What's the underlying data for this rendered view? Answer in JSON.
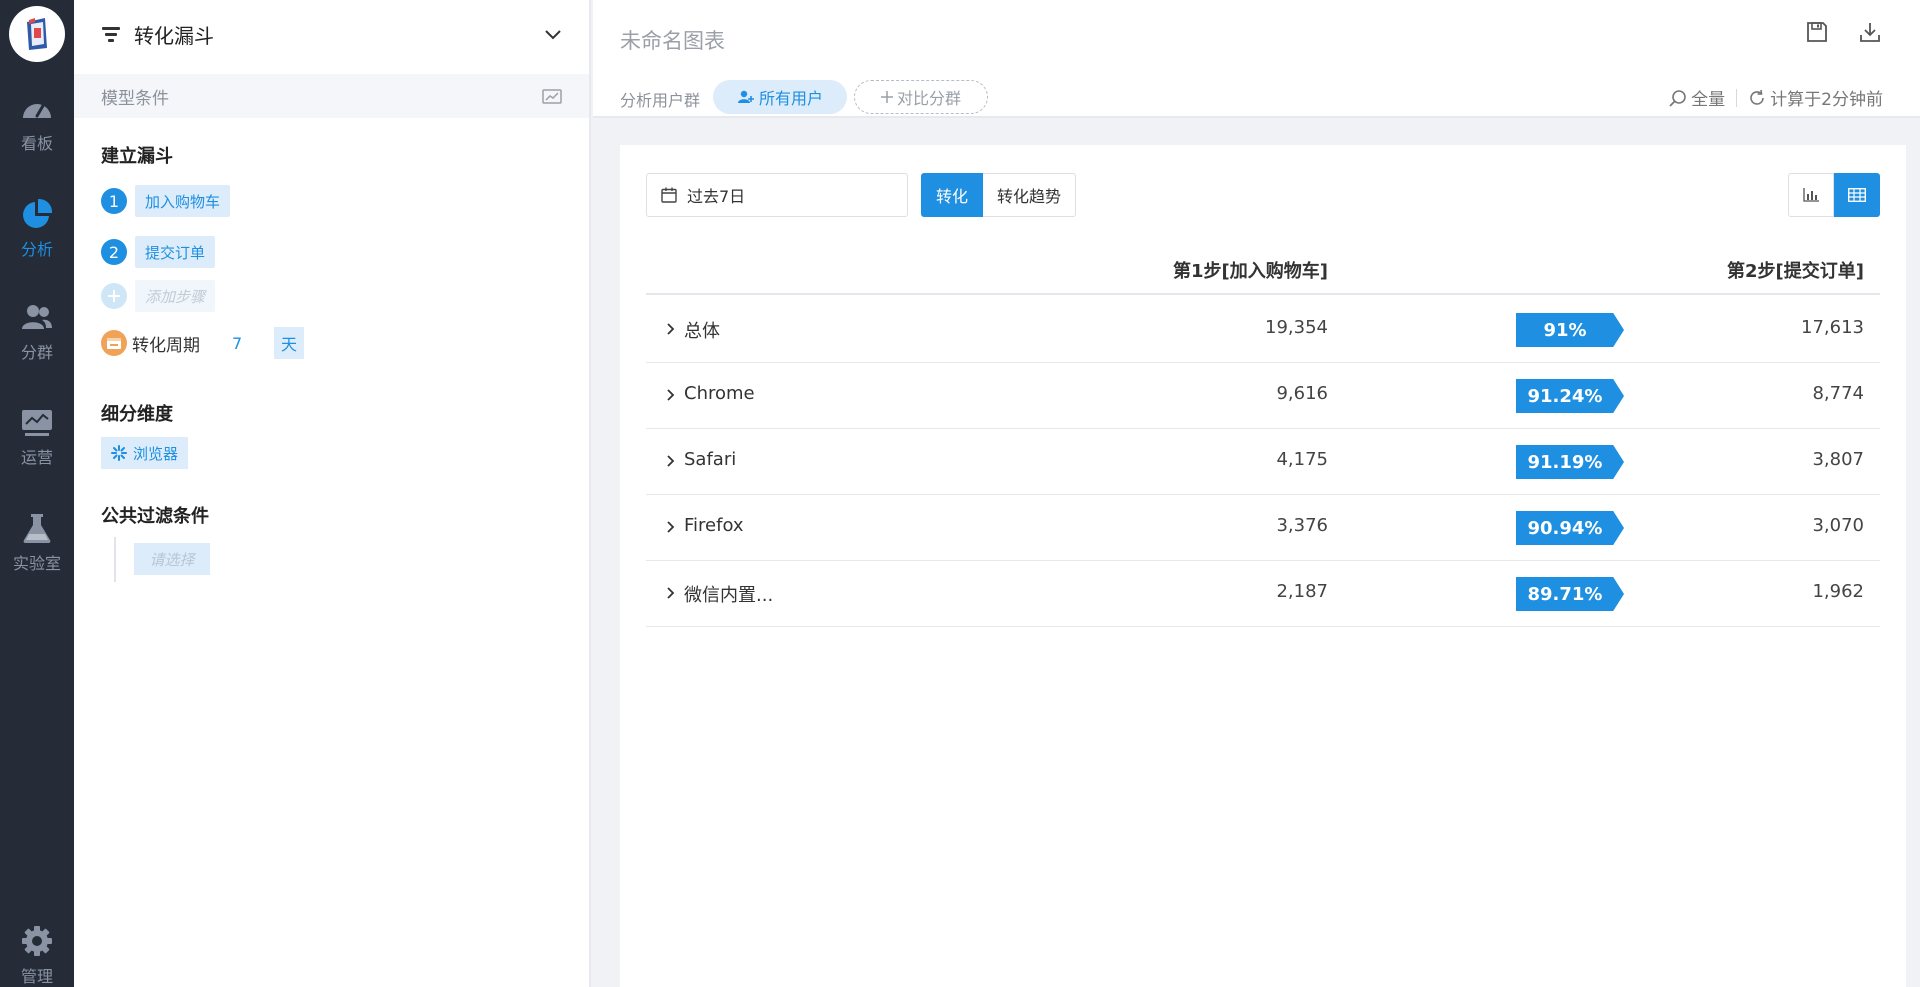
{
  "nav": {
    "logo": "app-logo",
    "items": [
      {
        "label": "看板",
        "icon": "dashboard-gauge-icon"
      },
      {
        "label": "分析",
        "icon": "pie-chart-icon",
        "active": true
      },
      {
        "label": "分群",
        "icon": "users-icon"
      },
      {
        "label": "运营",
        "icon": "monitor-chart-icon"
      },
      {
        "label": "实验室",
        "icon": "flask-icon"
      },
      {
        "label": "管理",
        "icon": "gear-icon"
      }
    ]
  },
  "panel": {
    "title": "转化漏斗",
    "model_conditions": "模型条件",
    "build_funnel": "建立漏斗",
    "steps": [
      {
        "num": "1",
        "label": "加入购物车"
      },
      {
        "num": "2",
        "label": "提交订单"
      }
    ],
    "add_step_placeholder": "添加步骤",
    "period_label": "转化周期",
    "period_value": "7",
    "period_unit": "天",
    "breakdown_title": "细分维度",
    "breakdown_tag": "浏览器",
    "filter_title": "公共过滤条件",
    "filter_placeholder": "请选择"
  },
  "header": {
    "chart_title": "未命名图表",
    "segment_label": "分析用户群",
    "segment_all": "所有用户",
    "segment_compare": "对比分群",
    "scope": "全量",
    "computed": "计算于2分钟前"
  },
  "toolbar": {
    "date_range": "过去7日",
    "tab_conversion": "转化",
    "tab_trend": "转化趋势"
  },
  "table": {
    "col_step1": "第1步[加入购物车]",
    "col_step2": "第2步[提交订单]",
    "rows": [
      {
        "name": "总体",
        "step1": "19,354",
        "rate": "91%",
        "step2": "17,613"
      },
      {
        "name": "Chrome",
        "step1": "9,616",
        "rate": "91.24%",
        "step2": "8,774"
      },
      {
        "name": "Safari",
        "step1": "4,175",
        "rate": "91.19%",
        "step2": "3,807"
      },
      {
        "name": "Firefox",
        "step1": "3,376",
        "rate": "90.94%",
        "step2": "3,070"
      },
      {
        "name": "微信内置...",
        "step1": "2,187",
        "rate": "89.71%",
        "step2": "1,962"
      }
    ]
  },
  "colors": {
    "accent": "#1e8fe1",
    "rail_bg": "#252c38",
    "tag_bg": "#dcecfa",
    "period_icon": "#f0a356"
  }
}
